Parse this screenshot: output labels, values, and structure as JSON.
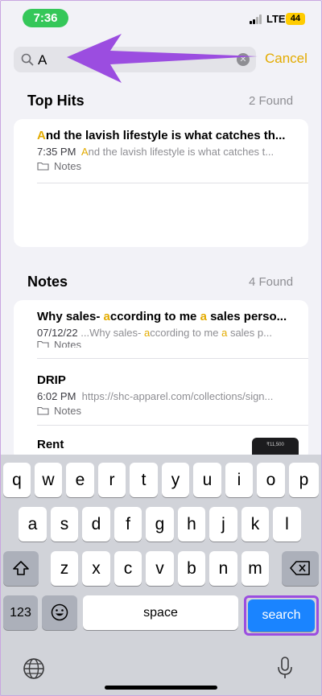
{
  "status_bar": {
    "time": "7:36",
    "network": "LTE",
    "battery": "44"
  },
  "search": {
    "value": "A",
    "cancel_label": "Cancel"
  },
  "top_hits": {
    "title": "Top Hits",
    "count": "2 Found",
    "items": [
      {
        "title_hl": "A",
        "title_rest": "nd the lavish lifestyle is what catches th...",
        "time": "7:35 PM",
        "snippet_hl": "A",
        "snippet_rest": "nd the lavish lifestyle is what catches t...",
        "folder": "Notes"
      }
    ]
  },
  "notes": {
    "title": "Notes",
    "count": "4 Found",
    "items": [
      {
        "title_a": "Why sales- ",
        "title_hl1": "a",
        "title_b": "ccording to me ",
        "title_hl2": "a",
        "title_c": " sales perso...",
        "date": "07/12/22",
        "snippet_a": "...Why sales- ",
        "snippet_hl1": "a",
        "snippet_b": "ccording to me ",
        "snippet_hl2": "a",
        "snippet_c": " sales p...",
        "folder": "Notes"
      },
      {
        "title": "DRIP",
        "time": "6:02 PM",
        "snippet": "https://shc-apparel.com/collections/sign...",
        "folder": "Notes"
      },
      {
        "title": "Rent",
        "thumb_text": "₹11,500"
      }
    ]
  },
  "keyboard": {
    "row1": [
      "q",
      "w",
      "e",
      "r",
      "t",
      "y",
      "u",
      "i",
      "o",
      "p"
    ],
    "row2": [
      "a",
      "s",
      "d",
      "f",
      "g",
      "h",
      "j",
      "k",
      "l"
    ],
    "row3": [
      "z",
      "x",
      "c",
      "v",
      "b",
      "n",
      "m"
    ],
    "numbers_label": "123",
    "space_label": "space",
    "search_label": "search"
  },
  "colors": {
    "accent": "#e3ab00",
    "annotation": "#9b4de0",
    "key_blue": "#1a84ff"
  },
  "icons": {
    "search": "search-icon",
    "clear": "clear-icon",
    "folder": "folder-icon",
    "shift": "shift-icon",
    "delete": "delete-icon",
    "emoji": "emoji-icon",
    "globe": "globe-icon",
    "mic": "microphone-icon"
  }
}
